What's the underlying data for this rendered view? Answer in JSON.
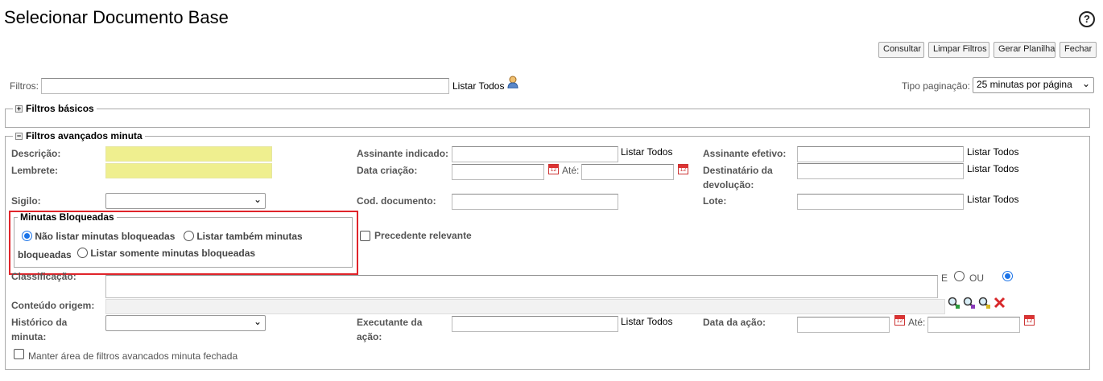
{
  "header": {
    "title": "Selecionar Documento Base",
    "help_icon": "?"
  },
  "toolbar": {
    "consultar": "Consultar",
    "limpar": "Limpar Filtros",
    "gerar": "Gerar Planilha",
    "fechar": "Fechar"
  },
  "filtros": {
    "label": "Filtros:",
    "value": "",
    "listar_todos": "Listar Todos",
    "user_icon": "user-icon",
    "tipo_paginacao_label": "Tipo paginação:",
    "tipo_paginacao_value": "25 minutas por página"
  },
  "filtros_basicos": {
    "toggle": "+",
    "legend": "Filtros básicos"
  },
  "filtros_avancados": {
    "toggle": "−",
    "legend": "Filtros avançados minuta",
    "descricao": "Descrição:",
    "lembrete": "Lembrete:",
    "sigilo": "Sigilo:",
    "sigilo_value": "",
    "assinante_indicado": "Assinante indicado:",
    "data_criacao": "Data criação:",
    "ate": "Até:",
    "cod_documento": "Cod. documento:",
    "assinante_efetivo": "Assinante efetivo:",
    "destinatario_1": "Destinatário da",
    "destinatario_2": "devolução:",
    "lote": "Lote:",
    "listar_todos": "Listar Todos",
    "minutas_bloqueadas": {
      "legend": "Minutas Bloqueadas",
      "opt1": "Não listar minutas bloqueadas",
      "opt2_a": "Listar também minutas",
      "opt2_b": "bloqueadas",
      "opt3": "Listar somente minutas bloqueadas",
      "selected": 1
    },
    "precedente": "Precedente relevante",
    "classificacao": "Classificação:",
    "e_label": "E",
    "ou_label": "OU",
    "conteudo_origem": "Conteúdo origem:",
    "historico_1": "Histórico da",
    "historico_2": "minuta:",
    "executante_1": "Executante da",
    "executante_2": "ação:",
    "data_acao": "Data da ação:",
    "manter": "Manter área de filtros avancados minuta fechada"
  },
  "colors": {
    "highlight_box": "#e0242a",
    "required_field": "#efef8f",
    "radio_accent": "#1a73e8"
  }
}
